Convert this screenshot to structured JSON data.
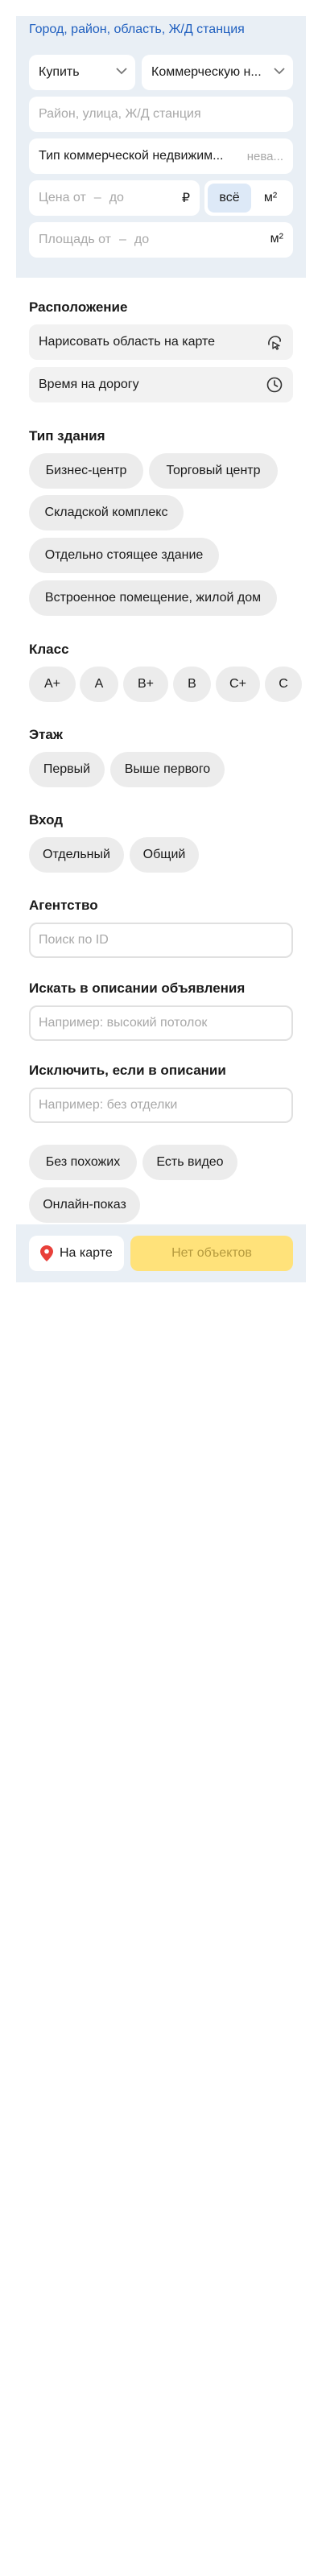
{
  "colors": {
    "panel_bg": "#e9eff5",
    "link": "#1f5fbf",
    "chip_bg": "#ececec",
    "accent_yellow": "#ffe27a",
    "pin_red": "#e8403a",
    "seg_active": "#dde9f7"
  },
  "header": {
    "region_link": "Город, район, область, Ж/Д станция"
  },
  "filters": {
    "deal_select": "Купить",
    "category_select": "Коммерческую н...",
    "geo_placeholder": "Район, улица, Ж/Д станция",
    "property_type": {
      "label": "Тип коммерческой недвижим...",
      "value_placeholder": "нева..."
    },
    "price": {
      "from": "Цена от",
      "dash": "–",
      "to": "до",
      "currency": "₽"
    },
    "price_unit": {
      "all": "всё",
      "per_m2": "м²"
    },
    "area": {
      "from": "Площадь от",
      "dash": "–",
      "to": "до",
      "unit": "м²"
    }
  },
  "location": {
    "title": "Расположение",
    "draw_area": "Нарисовать область на карте",
    "draw_icon": "draw-area-icon",
    "travel_time": "Время на дорогу",
    "travel_icon": "clock-icon"
  },
  "building_type": {
    "title": "Тип здания",
    "options": [
      "Бизнес-центр",
      "Торговый центр",
      "Складской комплекс",
      "Отдельно стоящее здание",
      "Встроенное помещение, жилой дом"
    ]
  },
  "class": {
    "title": "Класс",
    "options": [
      "A+",
      "A",
      "B+",
      "B",
      "C+",
      "C"
    ]
  },
  "floor": {
    "title": "Этаж",
    "options": [
      "Первый",
      "Выше первого"
    ]
  },
  "entrance": {
    "title": "Вход",
    "options": [
      "Отдельный",
      "Общий"
    ]
  },
  "agency": {
    "title": "Агентство",
    "placeholder": "Поиск по ID"
  },
  "search_description": {
    "title": "Искать в описании объявления",
    "placeholder": "Например: высокий потолок"
  },
  "exclude_description": {
    "title": "Исключить, если в описании",
    "placeholder": "Например: без отделки"
  },
  "extra": {
    "options": [
      "Без похожих",
      "Есть видео",
      "Онлайн-показ"
    ]
  },
  "footer": {
    "map_label": "На карте",
    "map_icon": "map-pin-icon",
    "result_label": "Нет объектов"
  }
}
